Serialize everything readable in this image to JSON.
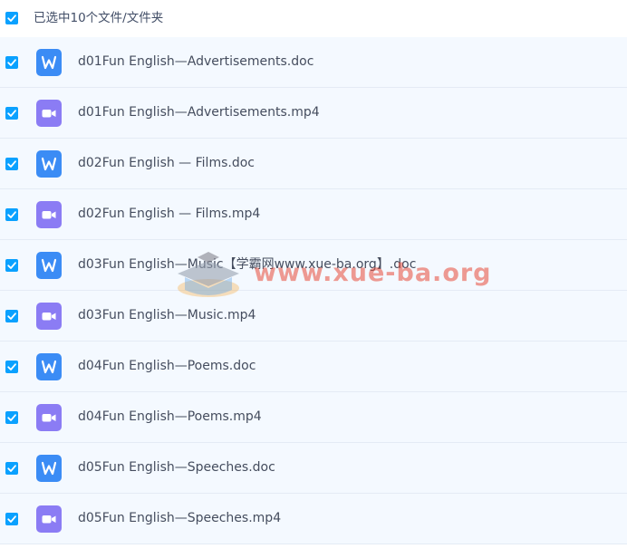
{
  "header": {
    "label": "已选中10个文件/文件夹",
    "checked": true
  },
  "colors": {
    "accent": "#0aa1ff",
    "row_bg": "#f4f9ff",
    "doc_icon": "#3b8cf5",
    "video_icon": "#8b7cf4",
    "text": "#454d5e"
  },
  "files": [
    {
      "name": "d01Fun English—Advertisements.doc",
      "type": "doc",
      "icon": "word-doc-icon",
      "checked": true
    },
    {
      "name": "d01Fun English—Advertisements.mp4",
      "type": "video",
      "icon": "video-file-icon",
      "checked": true
    },
    {
      "name": "d02Fun English — Films.doc",
      "type": "doc",
      "icon": "word-doc-icon",
      "checked": true
    },
    {
      "name": "d02Fun English — Films.mp4",
      "type": "video",
      "icon": "video-file-icon",
      "checked": true
    },
    {
      "name": "d03Fun English—Music【学霸网www.xue-ba.org】.doc",
      "type": "doc",
      "icon": "word-doc-icon",
      "checked": true
    },
    {
      "name": "d03Fun English—Music.mp4",
      "type": "video",
      "icon": "video-file-icon",
      "checked": true
    },
    {
      "name": "d04Fun English—Poems.doc",
      "type": "doc",
      "icon": "word-doc-icon",
      "checked": true
    },
    {
      "name": "d04Fun English—Poems.mp4",
      "type": "video",
      "icon": "video-file-icon",
      "checked": true
    },
    {
      "name": "d05Fun English—Speeches.doc",
      "type": "doc",
      "icon": "word-doc-icon",
      "checked": true
    },
    {
      "name": "d05Fun English—Speeches.mp4",
      "type": "video",
      "icon": "video-file-icon",
      "checked": true
    }
  ],
  "watermark": {
    "text": "www.xue-ba.org"
  }
}
